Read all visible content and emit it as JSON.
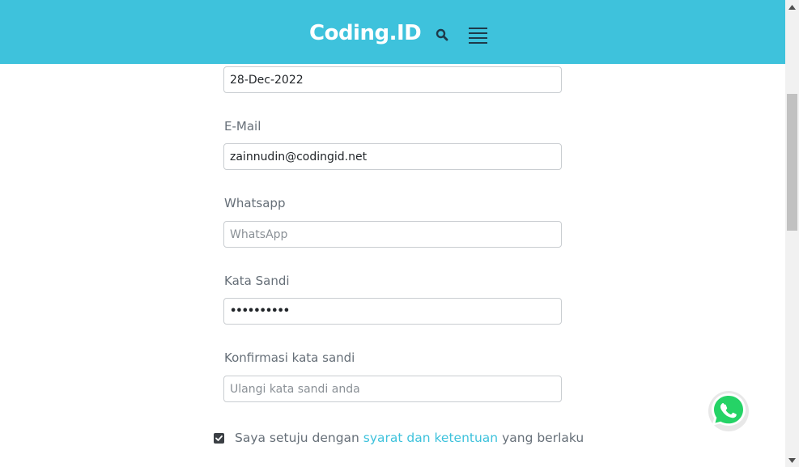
{
  "header": {
    "logo_text": "Coding.ID",
    "search_icon": "search-icon",
    "menu_icon": "hamburger-menu-icon",
    "background_color": "#3ec2dc"
  },
  "form": {
    "birth_date": {
      "value": "28-Dec-2022"
    },
    "email": {
      "label": "E-Mail",
      "value": "zainnudin@codingid.net"
    },
    "whatsapp": {
      "label": "Whatsapp",
      "placeholder": "WhatsApp",
      "value": ""
    },
    "password": {
      "label": "Kata Sandi",
      "value": "••••••••••"
    },
    "confirm_password": {
      "label": "Konfirmasi kata sandi",
      "placeholder": "Ulangi kata sandi anda",
      "value": ""
    },
    "agreement": {
      "checked": true,
      "text_before": "Saya setuju dengan ",
      "link_text": "syarat dan ketentuan",
      "text_after": " yang berlaku",
      "link_color": "#3ec2dc"
    }
  },
  "floating": {
    "whatsapp_icon": "whatsapp-icon",
    "color": "#25d366"
  }
}
